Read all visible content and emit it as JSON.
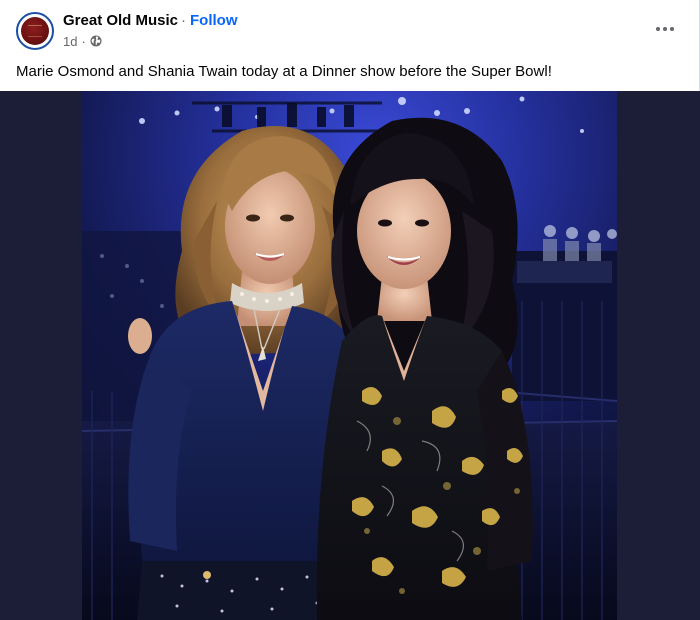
{
  "post": {
    "page_name": "Great Old Music",
    "separator": "·",
    "follow_label": "Follow",
    "timestamp": "1d",
    "meta_separator": "·",
    "audience_icon": "globe-icon",
    "more_icon": "more-horizontal-icon",
    "caption": "Marie Osmond and Shania Twain today at a Dinner show before the Super Bowl!"
  },
  "colors": {
    "link_blue": "#0866ff",
    "text_primary": "#050505",
    "text_secondary": "#65676b",
    "media_backdrop": "#1b1e36"
  }
}
